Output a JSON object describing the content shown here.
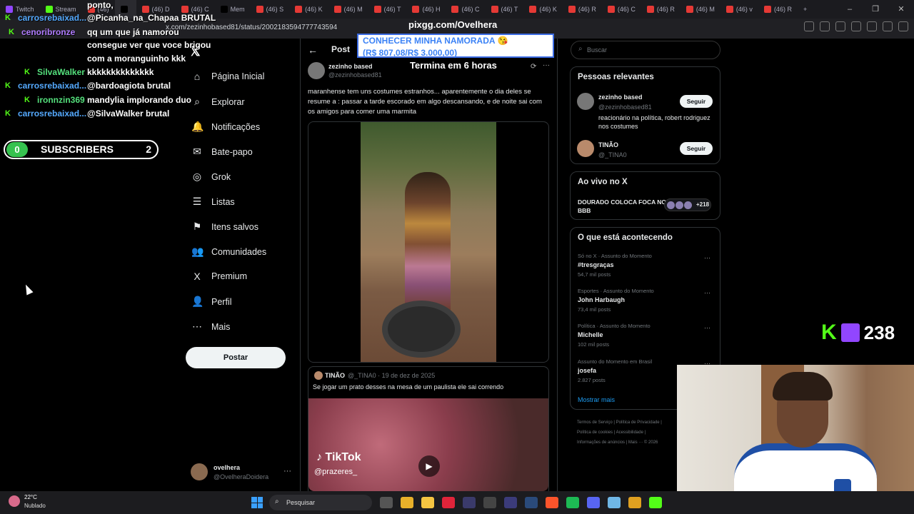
{
  "browser": {
    "tabs": [
      {
        "label": "Twitch",
        "color": "#9146ff"
      },
      {
        "label": "Stream",
        "color": "#53fc18"
      },
      {
        "label": "(46)",
        "color": "#e53935"
      },
      {
        "label": "",
        "color": "#000000"
      },
      {
        "label": "(46) D",
        "color": "#e53935"
      },
      {
        "label": "(46) C",
        "color": "#e53935"
      },
      {
        "label": "Mem",
        "color": "#000000"
      },
      {
        "label": "(46) S",
        "color": "#e53935"
      },
      {
        "label": "(46) K",
        "color": "#e53935"
      },
      {
        "label": "(46) M",
        "color": "#e53935"
      },
      {
        "label": "(46) T",
        "color": "#e53935"
      },
      {
        "label": "(46) H",
        "color": "#e53935"
      },
      {
        "label": "(46) C",
        "color": "#e53935"
      },
      {
        "label": "(46) T",
        "color": "#e53935"
      },
      {
        "label": "(46) K",
        "color": "#e53935"
      },
      {
        "label": "(46) R",
        "color": "#e53935"
      },
      {
        "label": "(46) C",
        "color": "#e53935"
      },
      {
        "label": "(46) R",
        "color": "#e53935"
      },
      {
        "label": "(46) M",
        "color": "#e53935"
      },
      {
        "label": "(46) v",
        "color": "#e53935"
      },
      {
        "label": "(46) R",
        "color": "#e53935"
      }
    ],
    "new_tab": "+",
    "url": "x.com/zezinhobased81/status/2002183594777743594",
    "window_controls": [
      "–",
      "❐",
      "✕"
    ]
  },
  "overlay": {
    "pixgg": "pixgg.com/Ovelhera",
    "banner_line1": "CONHECER MINHA NAMORADA 😘",
    "banner_line2": "(R$ 807,08/R$ 3.000,00)",
    "timer": "Termina em 6 horas",
    "chat": [
      {
        "name": "",
        "msg": "ponto,",
        "color": "#ffffff"
      },
      {
        "name": "carrosrebaixad...",
        "msg": "@Picanha_na_Chapaa BRUTAL",
        "color": "#55aaff"
      },
      {
        "name": "cenoribronze",
        "msg": "qq um que já namorou",
        "color": "#b07cff"
      },
      {
        "name": "",
        "msg": "consegue ver que voce brigou",
        "color": "#ffffff"
      },
      {
        "name": "",
        "msg": "com a moranguinho kkk",
        "color": "#ffffff"
      },
      {
        "name": "SilvaWalker",
        "msg": "kkkkkkkkkkkkkk",
        "color": "#54e07c"
      },
      {
        "name": "carrosrebaixad...",
        "msg": "@bardoagiota brutal",
        "color": "#55aaff"
      },
      {
        "name": "ironnzin369",
        "msg": "mandylia implorando duo",
        "color": "#54e07c"
      },
      {
        "name": "carrosrebaixad...",
        "msg": "@SilvaWalker brutal",
        "color": "#55aaff"
      }
    ],
    "subscribers": {
      "left": "0",
      "label": "SUBSCRIBERS",
      "right": "2"
    },
    "viewer_count": "238"
  },
  "sidebar": {
    "items": [
      {
        "icon": "⌂",
        "label": "Página Inicial"
      },
      {
        "icon": "⌕",
        "label": "Explorar"
      },
      {
        "icon": "🔔",
        "label": "Notificações"
      },
      {
        "icon": "✉",
        "label": "Bate-papo"
      },
      {
        "icon": "◎",
        "label": "Grok"
      },
      {
        "icon": "☰",
        "label": "Listas"
      },
      {
        "icon": "⚑",
        "label": "Itens salvos"
      },
      {
        "icon": "👥",
        "label": "Comunidades"
      },
      {
        "icon": "X",
        "label": "Premium"
      },
      {
        "icon": "👤",
        "label": "Perfil"
      },
      {
        "icon": "⋯",
        "label": "Mais"
      }
    ],
    "post_button": "Postar",
    "account": {
      "name": "ovelhera",
      "handle": "@OvelheraDoidera",
      "more": "···"
    }
  },
  "main": {
    "back": "←",
    "header": "Post",
    "author": {
      "name": "zezinho based",
      "handle": "@zezinhobased81"
    },
    "text": "maranhense tem uns costumes estranhos... aparentemente o dia deles se resume a : passar a tarde escorado em algo descansando, e de noite sai com os amigos para comer uma marmita",
    "quote": {
      "name": "TINÃO",
      "handle": "@_TINA0 · 19 de dez de 2025",
      "text": "Se jogar um prato desses na mesa de um paulista ele sai correndo",
      "brand": "TikTok",
      "brand_handle": "@prazeres_"
    }
  },
  "right": {
    "search_placeholder": "Buscar",
    "relevant_title": "Pessoas relevantes",
    "people": [
      {
        "name": "zezinho based",
        "handle": "@zezinhobased81",
        "bio": "reacionário na política, robert rodriguez nos costumes",
        "button": "Seguir"
      },
      {
        "name": "TINÃO",
        "handle": "@_TINA0",
        "bio": "",
        "button": "Seguir"
      }
    ],
    "live_title": "Ao vivo no X",
    "live_item": "DOURADO COLOCA FOCA NO BBB",
    "live_count": "+218",
    "happening_title": "O que está acontecendo",
    "trends": [
      {
        "meta": "Só no X · Assunto do Momento",
        "title": "#tresgraças",
        "count": "54,7 mil posts"
      },
      {
        "meta": "Esportes · Assunto do Momento",
        "title": "John Harbaugh",
        "count": "73,4 mil posts"
      },
      {
        "meta": "Política · Assunto do Momento",
        "title": "Michelle",
        "count": "102 mil posts"
      },
      {
        "meta": "Assunto do Momento em Brasil",
        "title": "josefa",
        "count": "2.827 posts"
      }
    ],
    "show_more": "Mostrar mais",
    "footer": [
      "Termos de Serviço  |  Política de Privacidade  |",
      "Política de cookies  |  Acessibilidade  |",
      "Informações de anúncios  |  Mais ···  © 2026"
    ]
  },
  "taskbar": {
    "temp": "22°C",
    "weather": "Nublado",
    "search": "Pesquisar"
  }
}
